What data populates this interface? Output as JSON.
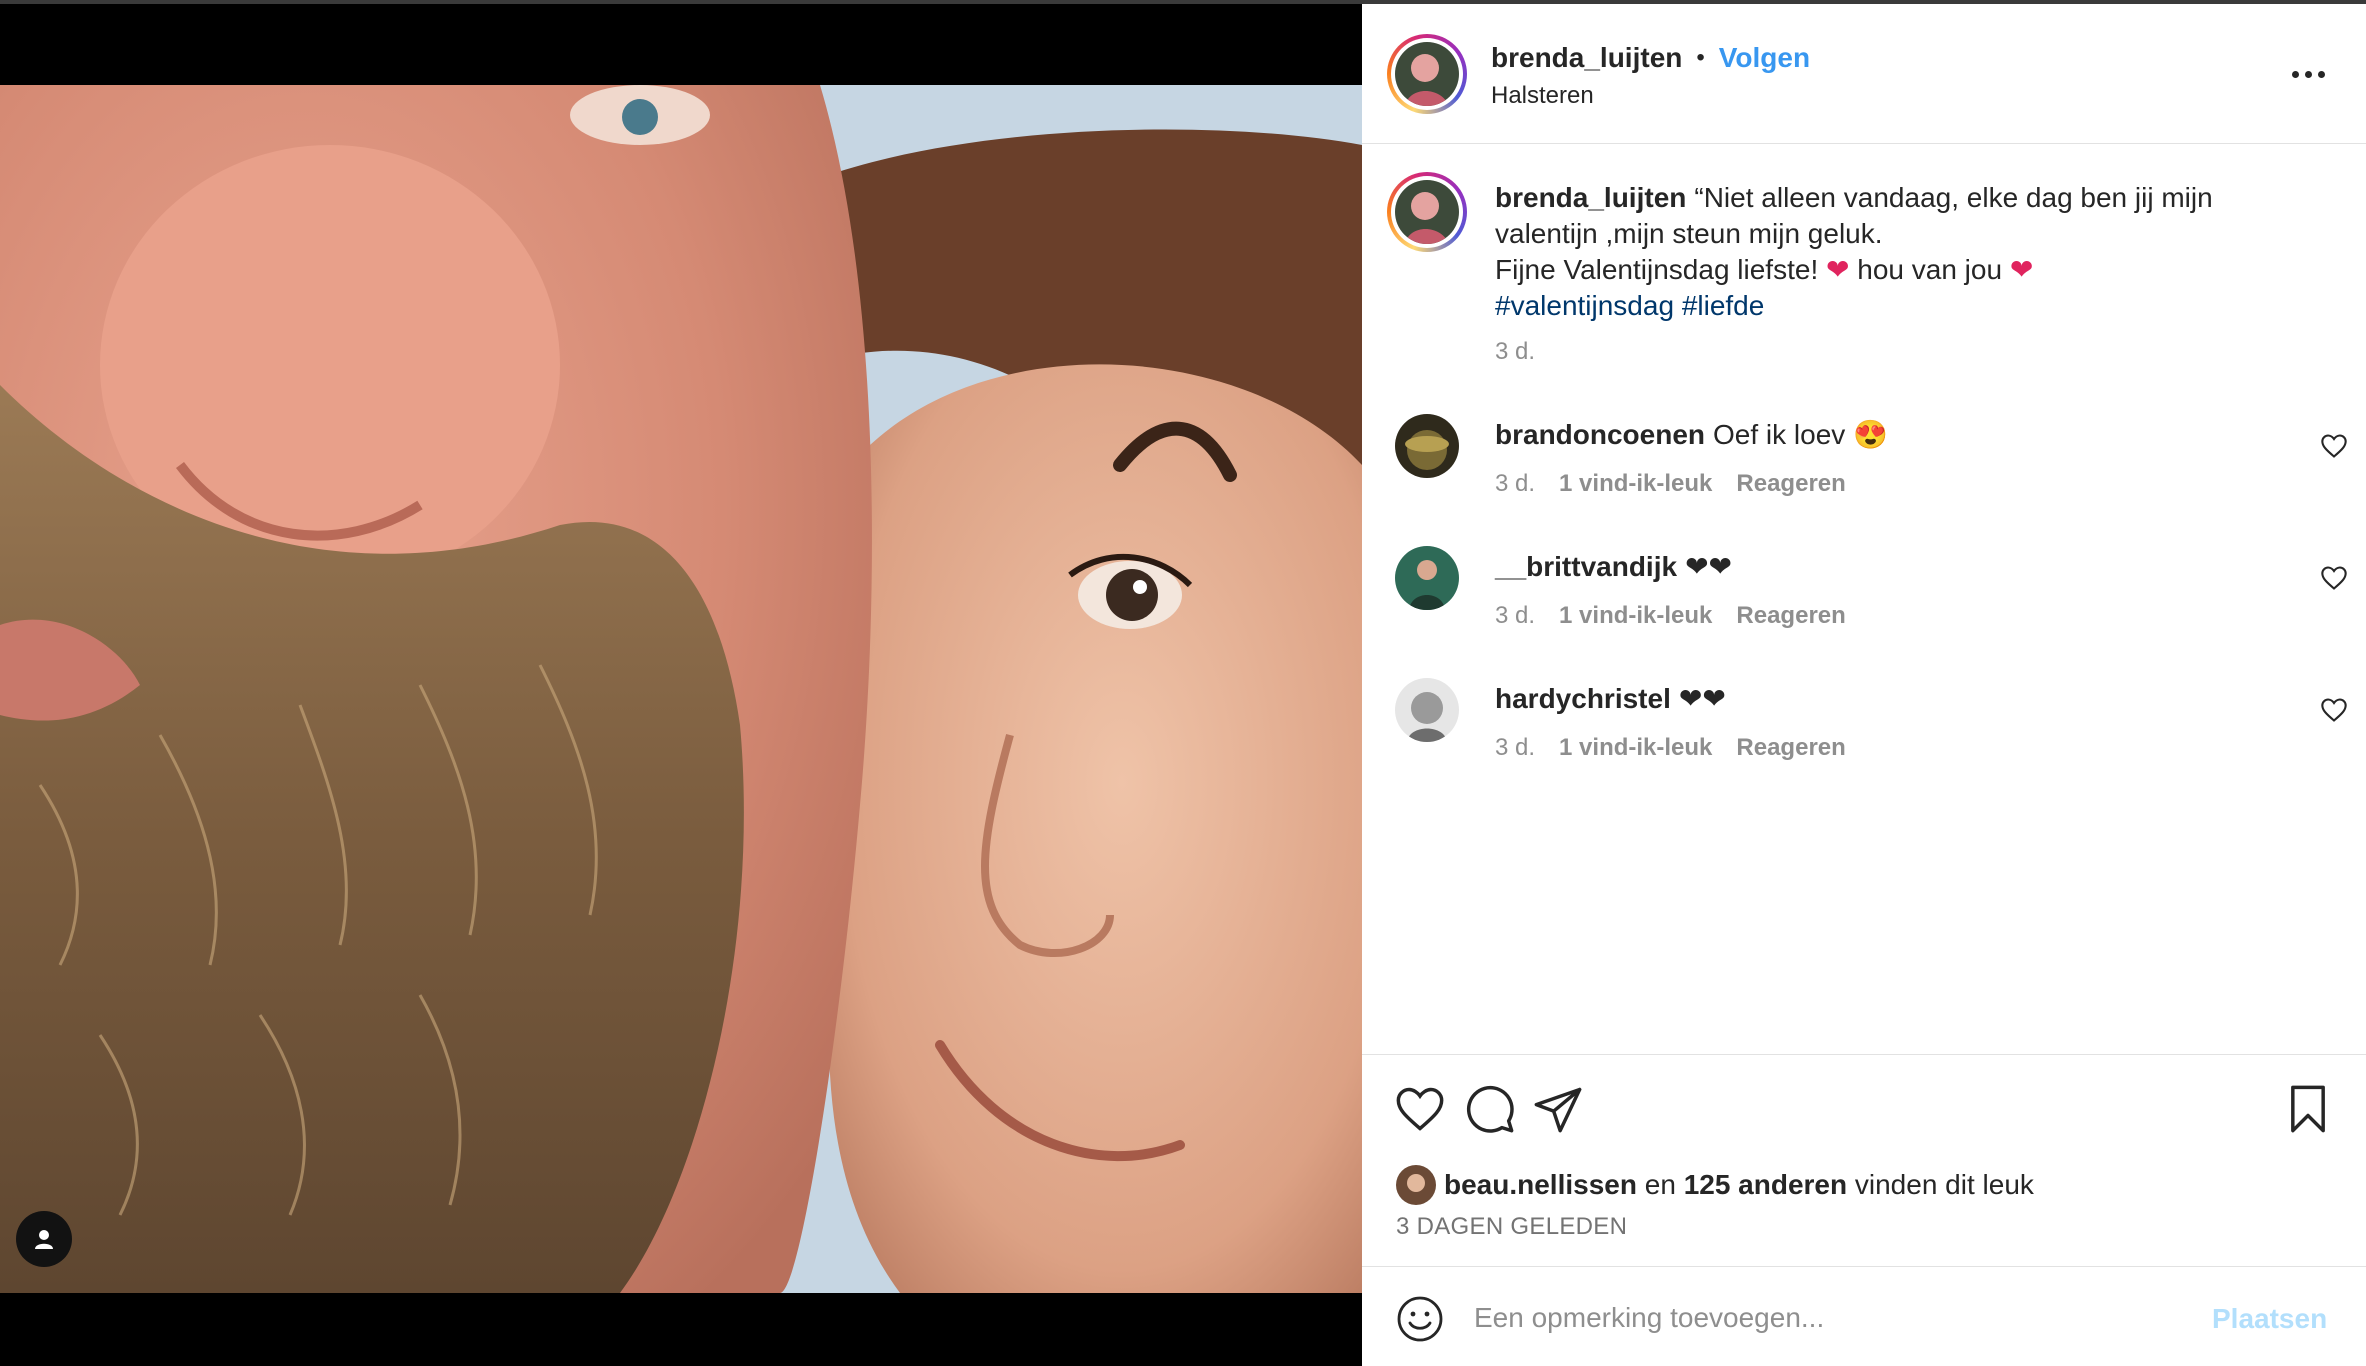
{
  "post": {
    "author": "brenda_luijten",
    "separator": "•",
    "follow_label": "Volgen",
    "location": "Halsteren",
    "more_icon": "more-horizontal-icon"
  },
  "caption": {
    "username": "brenda_luijten",
    "line1": "“Niet alleen vandaag, elke dag ben jij mijn",
    "line2": "valentijn ,mijn steun mijn geluk.",
    "line3_a": "Fijne Valentijnsdag liefste!",
    "heart1": "❤",
    "line3_b": "hou van jou",
    "heart2": "❤",
    "hashtag1": "#valentijnsdag",
    "hashtag2": "#liefde",
    "time": "3 d."
  },
  "comments": [
    {
      "username": "brandoncoenen",
      "text": "Oef ik loev 😍",
      "time": "3 d.",
      "likes": "1 vind-ik-leuk",
      "reply": "Reageren"
    },
    {
      "username": "__brittvandijk",
      "text": "❤❤",
      "time": "3 d.",
      "likes": "1 vind-ik-leuk",
      "reply": "Reageren"
    },
    {
      "username": "hardychristel",
      "text": "❤❤",
      "time": "3 d.",
      "likes": "1 vind-ik-leuk",
      "reply": "Reageren"
    }
  ],
  "actions": {
    "like_icon": "heart-icon",
    "comment_icon": "comment-icon",
    "share_icon": "share-icon",
    "save_icon": "bookmark-icon"
  },
  "likes": {
    "user": "beau.nellissen",
    "connector": "en",
    "others": "125 anderen",
    "suffix": "vinden dit leuk"
  },
  "post_time": "3 DAGEN GELEDEN",
  "add_comment": {
    "placeholder": "Een opmerking toevoegen...",
    "post_label": "Plaatsen"
  },
  "colors": {
    "link_blue": "#3897f0",
    "hashtag": "#00376b",
    "muted": "#8e8e8e",
    "post_disabled": "#b2dffc"
  }
}
